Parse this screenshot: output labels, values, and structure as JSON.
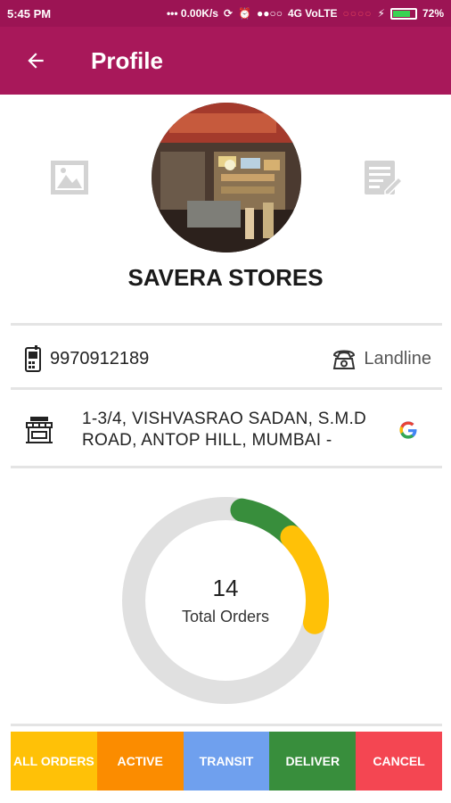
{
  "status_bar": {
    "time": "5:45 PM",
    "net_speed": "0.00K/s",
    "network": "4G VoLTE",
    "battery": "72%",
    "battery_level": 0.72
  },
  "app_bar": {
    "back_icon": "arrow-back-icon",
    "title": "Profile"
  },
  "profile": {
    "store_name": "SAVERA STORES",
    "gallery_icon": "gallery-icon",
    "edit_icon": "edit-note-icon"
  },
  "contact": {
    "mobile_icon": "mobile-phone-icon",
    "mobile": "9970912189",
    "landline_icon": "telephone-icon",
    "landline": "Landline"
  },
  "address": {
    "store_icon": "storefront-icon",
    "line1": "1-3/4, VISHVASRAO SADAN, S.M.D",
    "line2": "ROAD, ANTOP HILL, MUMBAI -",
    "map_icon": "google-icon"
  },
  "orders_chart": {
    "total": "14",
    "label": "Total Orders"
  },
  "chart_data": {
    "type": "pie",
    "style": "donut",
    "series": [
      {
        "value": 0.1,
        "color": "#388e3c"
      },
      {
        "value": 0.16,
        "color": "#ffc107"
      },
      {
        "value": 0.74,
        "color": "#e0e0e0"
      }
    ]
  },
  "tabs": [
    {
      "label": "ALL ORDERS",
      "color": "#ffc107"
    },
    {
      "label": "ACTIVE",
      "color": "#fb8c00"
    },
    {
      "label": "TRANSIT",
      "color": "#6fa0ee"
    },
    {
      "label": "DELIVER",
      "color": "#388e3c"
    },
    {
      "label": "CANCEL",
      "color": "#f44652"
    }
  ]
}
